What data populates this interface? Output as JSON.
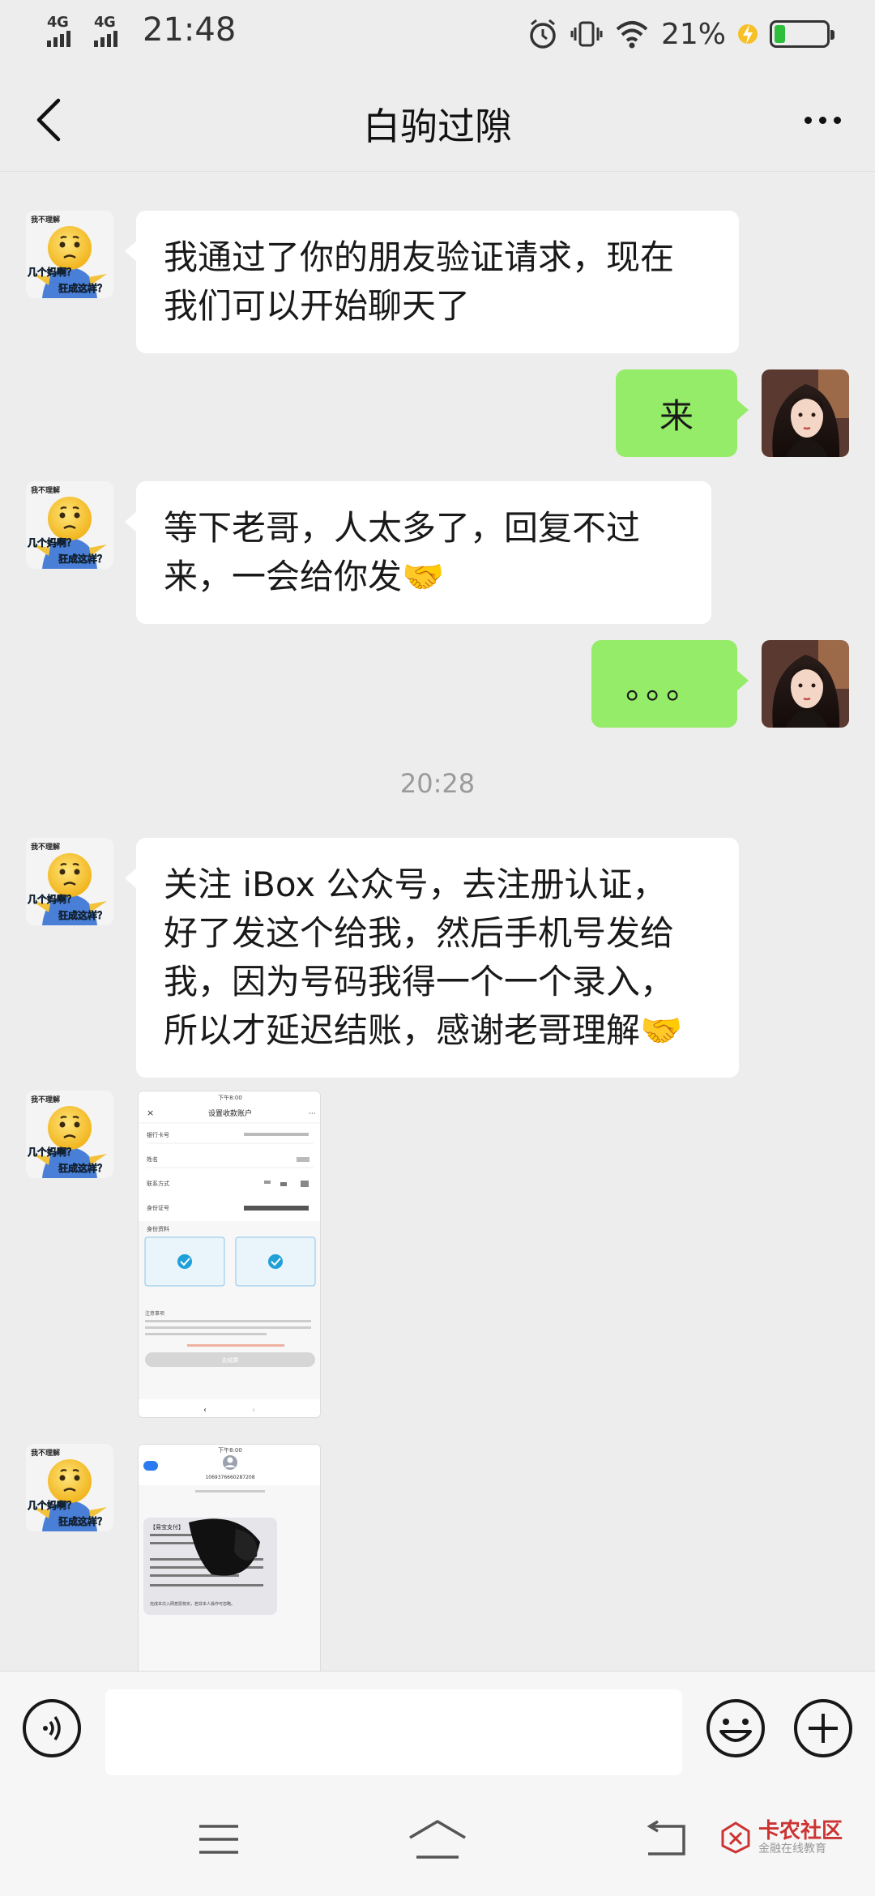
{
  "status_bar": {
    "net1": "4G",
    "net2": "4G",
    "time": "21:48",
    "battery_pct": "21%",
    "battery_level": 0.21
  },
  "nav": {
    "title": "白驹过隙"
  },
  "messages": [
    {
      "side": "in",
      "text_lines": [
        "我通过了你的朋友验证请求，现在",
        "我们可以开始聊天了"
      ]
    },
    {
      "side": "out",
      "text": "来"
    },
    {
      "side": "in",
      "text_lines": [
        "等下老哥，人太多了，回复不过",
        "来，一会给你发🤝"
      ]
    },
    {
      "side": "out",
      "text": "。。。"
    },
    {
      "type": "time",
      "text": "20:28"
    },
    {
      "side": "in",
      "text_lines": [
        "关注 iBox 公众号，去注册认证，",
        "好了发这个给我，然后手机号发给",
        "我，因为号码我得一个一个录入，",
        "所以才延迟结账，感谢老哥理解🤝"
      ]
    }
  ],
  "avatar_left": {
    "caption_top": "我不理解",
    "caption_mid": "几个妈啊？",
    "caption_bot": "狂成这样？"
  },
  "shot1": {
    "status": "下午8:00",
    "title": "设置收款账户",
    "rows": [
      "银行卡号",
      "姓名",
      "联系方式",
      "身份证号"
    ],
    "section": "身份资料",
    "note_title": "注意事项",
    "button": "去结算"
  },
  "shot2": {
    "status": "下午8:00",
    "number": "1069376660287208",
    "sms_head": "【易宝支付】",
    "sms_tail": "完成本次入网意愿核实，若非本人操作可忽略。"
  },
  "input": {
    "placeholder": ""
  },
  "watermark": {
    "name": "卡农社区",
    "sub": "金融在线教育"
  }
}
